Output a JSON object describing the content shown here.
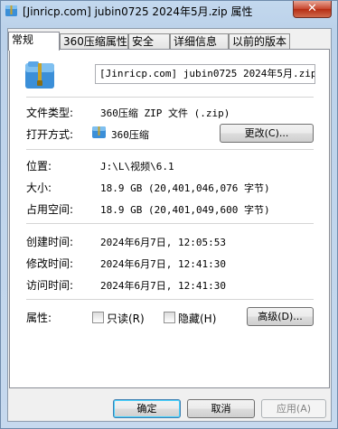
{
  "window": {
    "title": "[Jinricp.com] jubin0725 2024年5月.zip 属性",
    "close_glyph": "✕"
  },
  "tabs": [
    {
      "label": "常规"
    },
    {
      "label": "360压缩属性"
    },
    {
      "label": "安全"
    },
    {
      "label": "详细信息"
    },
    {
      "label": "以前的版本"
    }
  ],
  "file": {
    "name": "[Jinricp.com] jubin0725 2024年5月.zip"
  },
  "properties": {
    "type_label": "文件类型:",
    "type_value": "360压缩 ZIP 文件 (.zip)",
    "opens_with_label": "打开方式:",
    "opens_with_value": "360压缩",
    "change_button": "更改(C)...",
    "location_label": "位置:",
    "location_value": "J:\\L\\视频\\6.1",
    "size_label": "大小:",
    "size_value": "18.9 GB (20,401,046,076 字节)",
    "size_on_disk_label": "占用空间:",
    "size_on_disk_value": "18.9 GB (20,401,049,600 字节)",
    "created_label": "创建时间:",
    "created_value": "2024年6月7日, 12:05:53",
    "modified_label": "修改时间:",
    "modified_value": "2024年6月7日, 12:41:30",
    "accessed_label": "访问时间:",
    "accessed_value": "2024年6月7日, 12:41:30",
    "attributes_label": "属性:",
    "readonly_label": "只读(R)",
    "readonly_checked": false,
    "hidden_label": "隐藏(H)",
    "hidden_checked": false,
    "advanced_button": "高级(D)..."
  },
  "footer": {
    "ok": "确定",
    "cancel": "取消",
    "apply": "应用(A)"
  },
  "colors": {
    "zip_blue": "#3b8fd8",
    "zip_light": "#7fc0f0",
    "zip_zipper": "#c9a227"
  }
}
